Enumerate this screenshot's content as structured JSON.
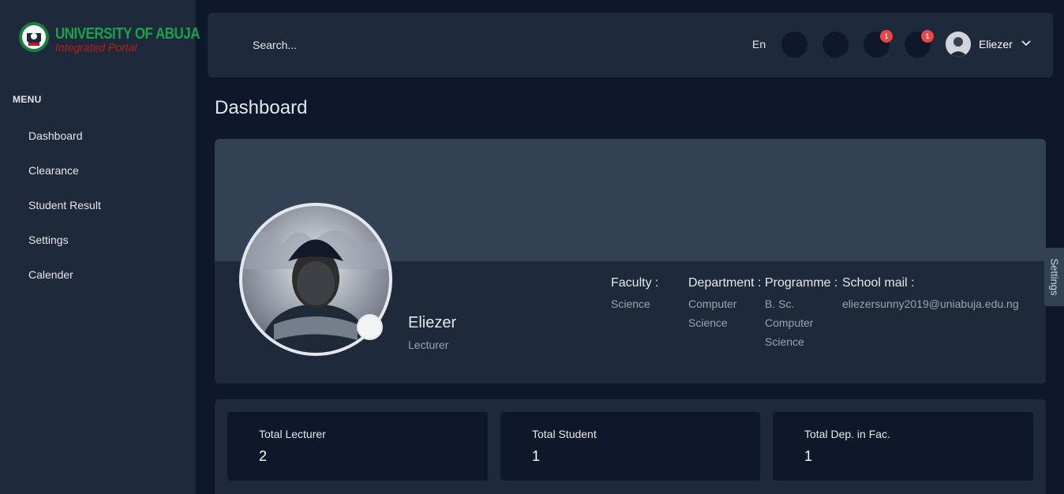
{
  "brand": {
    "title": "UNIVERSITY OF ABUJA",
    "subtitle": "Integrated Portal",
    "colors": {
      "title": "#16a34a",
      "subtitle": "#b91c1c"
    }
  },
  "sidebar": {
    "menu_title": "MENU",
    "items": [
      {
        "label": "Dashboard"
      },
      {
        "label": "Clearance"
      },
      {
        "label": "Student Result"
      },
      {
        "label": "Settings"
      },
      {
        "label": "Calender"
      }
    ]
  },
  "header": {
    "search_placeholder": "Search...",
    "language": "En",
    "icons": [
      {
        "name": "fullscreen-icon",
        "badge": ""
      },
      {
        "name": "theme-toggle-icon",
        "badge": ""
      },
      {
        "name": "notification-icon",
        "badge": "1"
      },
      {
        "name": "message-icon",
        "badge": "1"
      }
    ],
    "user_name": "Eliezer",
    "badge_color": "#ef4444"
  },
  "page": {
    "title": "Dashboard"
  },
  "profile": {
    "name": "Eliezer",
    "role": "Lecturer",
    "fields": [
      {
        "label": "Faculty :",
        "value": "Science"
      },
      {
        "label": "Department :",
        "value": "Computer Science"
      },
      {
        "label": "Programme :",
        "value": "B. Sc. Computer Science"
      },
      {
        "label": "School mail :",
        "value": "eliezersunny2019@uniabuja.edu.ng"
      }
    ]
  },
  "settings_tab": {
    "label": "Settings"
  },
  "stats": [
    {
      "label": "Total Lecturer",
      "value": "2"
    },
    {
      "label": "Total Student",
      "value": "1"
    },
    {
      "label": "Total Dep. in Fac.",
      "value": "1"
    }
  ]
}
